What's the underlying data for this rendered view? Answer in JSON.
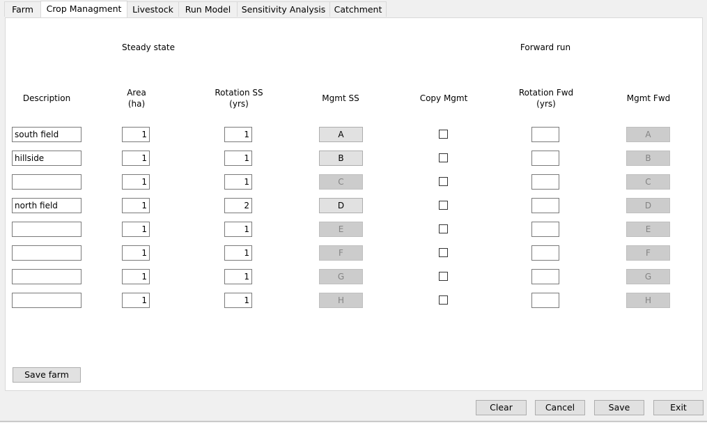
{
  "tabs": [
    {
      "label": "Farm"
    },
    {
      "label": "Crop Managment"
    },
    {
      "label": "Livestock"
    },
    {
      "label": "Run Model"
    },
    {
      "label": "Sensitivity Analysis"
    },
    {
      "label": "Catchment"
    }
  ],
  "active_tab": "Crop Managment",
  "headings": {
    "steady_state": "Steady state",
    "forward_run": "Forward run"
  },
  "columns": {
    "description": "Description",
    "area_1": "Area",
    "area_2": "(ha)",
    "rotation_ss_1": "Rotation SS",
    "rotation_ss_2": "(yrs)",
    "mgmt_ss": "Mgmt SS",
    "copy_mgmt": "Copy Mgmt",
    "rotation_fwd_1": "Rotation Fwd",
    "rotation_fwd_2": "(yrs)",
    "mgmt_fwd": "Mgmt Fwd"
  },
  "rows": [
    {
      "description": "south field",
      "area": "1",
      "rotation_ss": "1",
      "mgmt_ss": "A",
      "mgmt_ss_enabled": true,
      "copy_mgmt": false,
      "rotation_fwd": "",
      "mgmt_fwd": "A"
    },
    {
      "description": "hillside",
      "area": "1",
      "rotation_ss": "1",
      "mgmt_ss": "B",
      "mgmt_ss_enabled": true,
      "copy_mgmt": false,
      "rotation_fwd": "",
      "mgmt_fwd": "B"
    },
    {
      "description": "",
      "area": "1",
      "rotation_ss": "1",
      "mgmt_ss": "C",
      "mgmt_ss_enabled": false,
      "copy_mgmt": false,
      "rotation_fwd": "",
      "mgmt_fwd": "C"
    },
    {
      "description": "north field",
      "area": "1",
      "rotation_ss": "2",
      "mgmt_ss": "D",
      "mgmt_ss_enabled": true,
      "copy_mgmt": false,
      "rotation_fwd": "",
      "mgmt_fwd": "D"
    },
    {
      "description": "",
      "area": "1",
      "rotation_ss": "1",
      "mgmt_ss": "E",
      "mgmt_ss_enabled": false,
      "copy_mgmt": false,
      "rotation_fwd": "",
      "mgmt_fwd": "E"
    },
    {
      "description": "",
      "area": "1",
      "rotation_ss": "1",
      "mgmt_ss": "F",
      "mgmt_ss_enabled": false,
      "copy_mgmt": false,
      "rotation_fwd": "",
      "mgmt_fwd": "F"
    },
    {
      "description": "",
      "area": "1",
      "rotation_ss": "1",
      "mgmt_ss": "G",
      "mgmt_ss_enabled": false,
      "copy_mgmt": false,
      "rotation_fwd": "",
      "mgmt_fwd": "G"
    },
    {
      "description": "",
      "area": "1",
      "rotation_ss": "1",
      "mgmt_ss": "H",
      "mgmt_ss_enabled": false,
      "copy_mgmt": false,
      "rotation_fwd": "",
      "mgmt_fwd": "H"
    }
  ],
  "buttons": {
    "save_farm": "Save farm",
    "clear": "Clear",
    "cancel": "Cancel",
    "save": "Save",
    "exit": "Exit"
  }
}
